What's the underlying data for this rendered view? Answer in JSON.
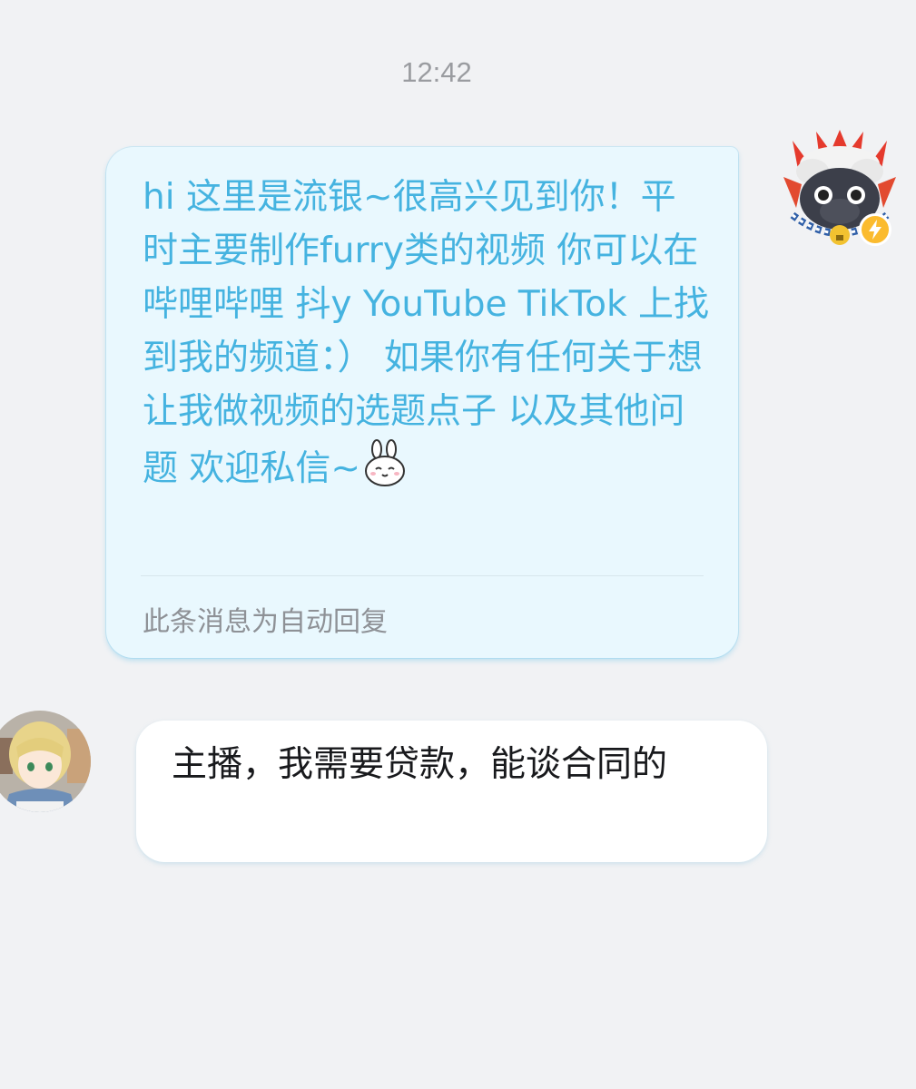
{
  "conversation": {
    "timestamp": "12:42"
  },
  "auto_reply": {
    "text": "hi 这里是流银~很高兴见到你！平时主要制作furry类的视频 你可以在哔哩哔哩 抖y YouTube TikTok 上找到我的频道：） 如果你有任何关于想让我做视频的选题点子 以及其他问题 欢迎私信~",
    "emoji_icon": "bunny-sticker-icon",
    "note": "此条消息为自动回复"
  },
  "user_message": {
    "text": "主播，我需要贷款，能谈合同的"
  },
  "colors": {
    "background": "#f1f2f4",
    "auto_reply_bg": "#e9f8fe",
    "auto_reply_text": "#45b3e0",
    "user_bubble_bg": "#ffffff",
    "badge": "#fbbb2e"
  }
}
